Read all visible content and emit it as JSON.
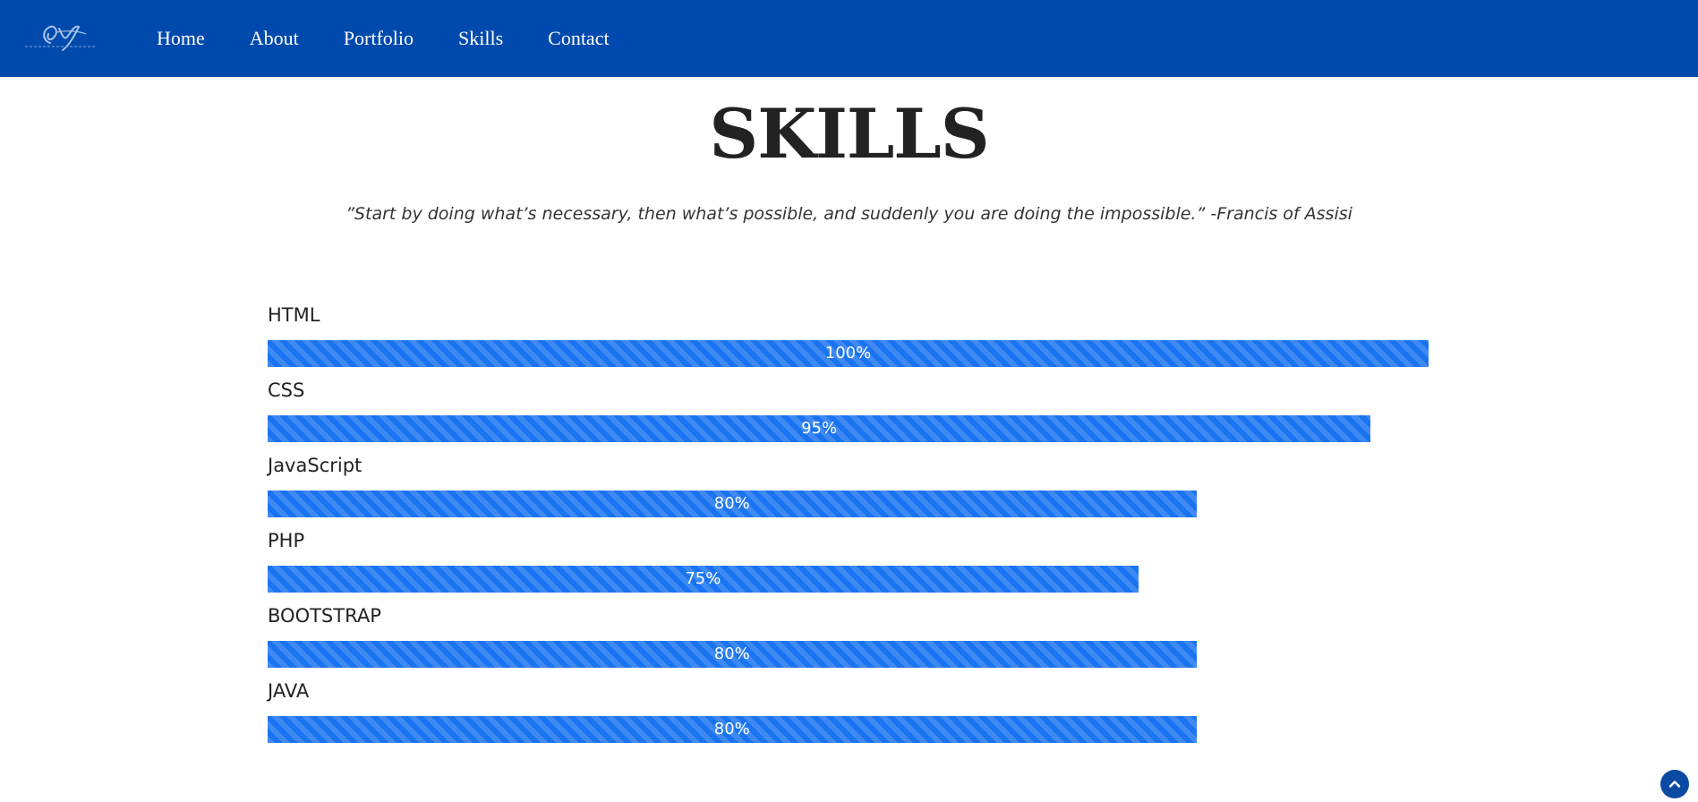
{
  "nav": {
    "logo_icon": "signature-logo",
    "links": [
      "Home",
      "About",
      "Portfolio",
      "Skills",
      "Contact"
    ]
  },
  "section": {
    "title": "SKILLS",
    "quote": "”Start by doing what’s necessary, then what’s possible, and suddenly you are doing the impossible.” -Francis of Assisi"
  },
  "skills": [
    {
      "name": "HTML",
      "percent": 100,
      "label": "100%"
    },
    {
      "name": "CSS",
      "percent": 95,
      "label": "95%"
    },
    {
      "name": "JavaScript",
      "percent": 80,
      "label": "80%"
    },
    {
      "name": "PHP",
      "percent": 75,
      "label": "75%"
    },
    {
      "name": "BOOTSTRAP",
      "percent": 80,
      "label": "80%"
    },
    {
      "name": "JAVA",
      "percent": 80,
      "label": "80%"
    }
  ],
  "colors": {
    "navbar": "#004aad",
    "bar": "#1a73f0",
    "title": "#222222"
  },
  "scroll_top_icon": "chevron-up-icon"
}
